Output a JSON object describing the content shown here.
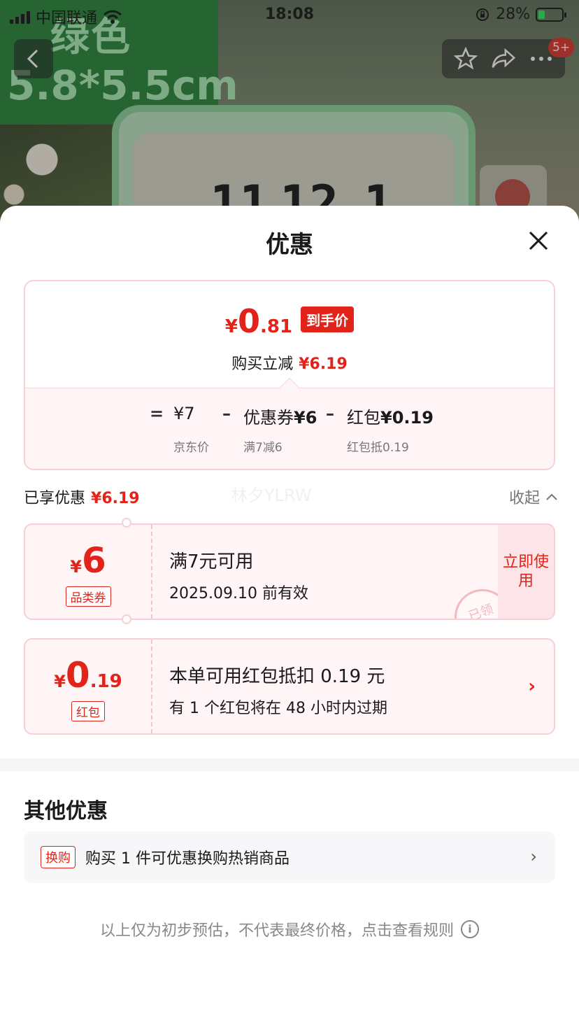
{
  "status_bar": {
    "carrier": "中国联通",
    "time": "18:08",
    "battery_percent": "28%",
    "battery_level": 0.28
  },
  "background": {
    "color_label": "绿色",
    "size_label": "5.8*5.5cm",
    "cart_badge": "5+",
    "icons": [
      "back-icon",
      "star-icon",
      "share-icon",
      "more-icon"
    ]
  },
  "sheet": {
    "title": "优惠",
    "final_price": {
      "currency": "¥",
      "integer": "0",
      "decimal": ".81",
      "tag": "到手价"
    },
    "save_label": "购买立减",
    "save_amount": "¥6.19",
    "breakdown": {
      "equals": "=",
      "base_price": "¥7",
      "base_label": "京东价",
      "minus1": "–",
      "coupon_label": "优惠券",
      "coupon_amount": "¥6",
      "coupon_desc": "满7减6",
      "minus2": "–",
      "redpacket_label": "红包",
      "redpacket_amount": "¥0.19",
      "redpacket_desc": "红包抵0.19"
    },
    "enjoyed_label": "已享优惠",
    "enjoyed_amount": "¥6.19",
    "collapse_label": "收起",
    "watermark": "林夕YLRW",
    "coupon_card": {
      "currency": "¥",
      "amount": "6",
      "type": "品类券",
      "condition": "满7元可用",
      "validity": "2025.09.10 前有效",
      "button": "立即使用",
      "stamp": "已领"
    },
    "redpacket_card": {
      "currency": "¥",
      "integer": "0",
      "decimal": ".19",
      "type": "红包",
      "main": "本单可用红包抵扣 0.19 元",
      "sub": "有 1 个红包将在 48 小时内过期"
    },
    "other_title": "其他优惠",
    "other_item": {
      "tag": "换购",
      "text": "购买 1 件可优惠换购热销商品"
    },
    "footnote": "以上仅为初步预估，不代表最终价格，点击查看规则"
  },
  "colors": {
    "accent_red": "#e2231a",
    "card_border": "#f7cfd4",
    "card_bg": "#fff5f6"
  }
}
